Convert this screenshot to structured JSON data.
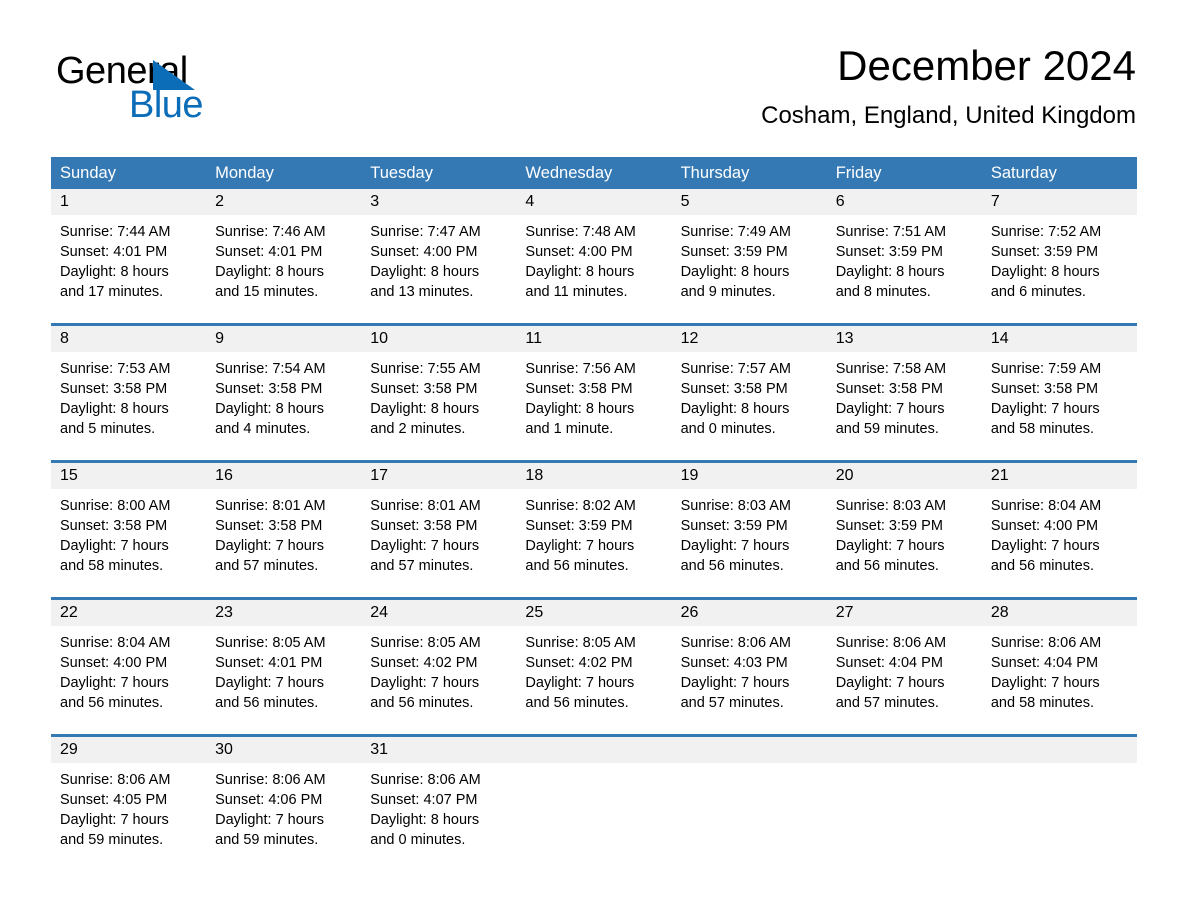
{
  "brand": {
    "name_part1": "General",
    "name_part2": "Blue",
    "triangle_color": "#0b6cb8"
  },
  "header": {
    "title": "December 2024",
    "location": "Cosham, England, United Kingdom"
  },
  "theme": {
    "header_blue": "#3579b4",
    "daynumber_band": "#f1f1f1",
    "text": "#000000"
  },
  "weekdays": [
    "Sunday",
    "Monday",
    "Tuesday",
    "Wednesday",
    "Thursday",
    "Friday",
    "Saturday"
  ],
  "weeks": [
    [
      {
        "day": "1",
        "sunrise": "Sunrise: 7:44 AM",
        "sunset": "Sunset: 4:01 PM",
        "daylight1": "Daylight: 8 hours",
        "daylight2": "and 17 minutes."
      },
      {
        "day": "2",
        "sunrise": "Sunrise: 7:46 AM",
        "sunset": "Sunset: 4:01 PM",
        "daylight1": "Daylight: 8 hours",
        "daylight2": "and 15 minutes."
      },
      {
        "day": "3",
        "sunrise": "Sunrise: 7:47 AM",
        "sunset": "Sunset: 4:00 PM",
        "daylight1": "Daylight: 8 hours",
        "daylight2": "and 13 minutes."
      },
      {
        "day": "4",
        "sunrise": "Sunrise: 7:48 AM",
        "sunset": "Sunset: 4:00 PM",
        "daylight1": "Daylight: 8 hours",
        "daylight2": "and 11 minutes."
      },
      {
        "day": "5",
        "sunrise": "Sunrise: 7:49 AM",
        "sunset": "Sunset: 3:59 PM",
        "daylight1": "Daylight: 8 hours",
        "daylight2": "and 9 minutes."
      },
      {
        "day": "6",
        "sunrise": "Sunrise: 7:51 AM",
        "sunset": "Sunset: 3:59 PM",
        "daylight1": "Daylight: 8 hours",
        "daylight2": "and 8 minutes."
      },
      {
        "day": "7",
        "sunrise": "Sunrise: 7:52 AM",
        "sunset": "Sunset: 3:59 PM",
        "daylight1": "Daylight: 8 hours",
        "daylight2": "and 6 minutes."
      }
    ],
    [
      {
        "day": "8",
        "sunrise": "Sunrise: 7:53 AM",
        "sunset": "Sunset: 3:58 PM",
        "daylight1": "Daylight: 8 hours",
        "daylight2": "and 5 minutes."
      },
      {
        "day": "9",
        "sunrise": "Sunrise: 7:54 AM",
        "sunset": "Sunset: 3:58 PM",
        "daylight1": "Daylight: 8 hours",
        "daylight2": "and 4 minutes."
      },
      {
        "day": "10",
        "sunrise": "Sunrise: 7:55 AM",
        "sunset": "Sunset: 3:58 PM",
        "daylight1": "Daylight: 8 hours",
        "daylight2": "and 2 minutes."
      },
      {
        "day": "11",
        "sunrise": "Sunrise: 7:56 AM",
        "sunset": "Sunset: 3:58 PM",
        "daylight1": "Daylight: 8 hours",
        "daylight2": "and 1 minute."
      },
      {
        "day": "12",
        "sunrise": "Sunrise: 7:57 AM",
        "sunset": "Sunset: 3:58 PM",
        "daylight1": "Daylight: 8 hours",
        "daylight2": "and 0 minutes."
      },
      {
        "day": "13",
        "sunrise": "Sunrise: 7:58 AM",
        "sunset": "Sunset: 3:58 PM",
        "daylight1": "Daylight: 7 hours",
        "daylight2": "and 59 minutes."
      },
      {
        "day": "14",
        "sunrise": "Sunrise: 7:59 AM",
        "sunset": "Sunset: 3:58 PM",
        "daylight1": "Daylight: 7 hours",
        "daylight2": "and 58 minutes."
      }
    ],
    [
      {
        "day": "15",
        "sunrise": "Sunrise: 8:00 AM",
        "sunset": "Sunset: 3:58 PM",
        "daylight1": "Daylight: 7 hours",
        "daylight2": "and 58 minutes."
      },
      {
        "day": "16",
        "sunrise": "Sunrise: 8:01 AM",
        "sunset": "Sunset: 3:58 PM",
        "daylight1": "Daylight: 7 hours",
        "daylight2": "and 57 minutes."
      },
      {
        "day": "17",
        "sunrise": "Sunrise: 8:01 AM",
        "sunset": "Sunset: 3:58 PM",
        "daylight1": "Daylight: 7 hours",
        "daylight2": "and 57 minutes."
      },
      {
        "day": "18",
        "sunrise": "Sunrise: 8:02 AM",
        "sunset": "Sunset: 3:59 PM",
        "daylight1": "Daylight: 7 hours",
        "daylight2": "and 56 minutes."
      },
      {
        "day": "19",
        "sunrise": "Sunrise: 8:03 AM",
        "sunset": "Sunset: 3:59 PM",
        "daylight1": "Daylight: 7 hours",
        "daylight2": "and 56 minutes."
      },
      {
        "day": "20",
        "sunrise": "Sunrise: 8:03 AM",
        "sunset": "Sunset: 3:59 PM",
        "daylight1": "Daylight: 7 hours",
        "daylight2": "and 56 minutes."
      },
      {
        "day": "21",
        "sunrise": "Sunrise: 8:04 AM",
        "sunset": "Sunset: 4:00 PM",
        "daylight1": "Daylight: 7 hours",
        "daylight2": "and 56 minutes."
      }
    ],
    [
      {
        "day": "22",
        "sunrise": "Sunrise: 8:04 AM",
        "sunset": "Sunset: 4:00 PM",
        "daylight1": "Daylight: 7 hours",
        "daylight2": "and 56 minutes."
      },
      {
        "day": "23",
        "sunrise": "Sunrise: 8:05 AM",
        "sunset": "Sunset: 4:01 PM",
        "daylight1": "Daylight: 7 hours",
        "daylight2": "and 56 minutes."
      },
      {
        "day": "24",
        "sunrise": "Sunrise: 8:05 AM",
        "sunset": "Sunset: 4:02 PM",
        "daylight1": "Daylight: 7 hours",
        "daylight2": "and 56 minutes."
      },
      {
        "day": "25",
        "sunrise": "Sunrise: 8:05 AM",
        "sunset": "Sunset: 4:02 PM",
        "daylight1": "Daylight: 7 hours",
        "daylight2": "and 56 minutes."
      },
      {
        "day": "26",
        "sunrise": "Sunrise: 8:06 AM",
        "sunset": "Sunset: 4:03 PM",
        "daylight1": "Daylight: 7 hours",
        "daylight2": "and 57 minutes."
      },
      {
        "day": "27",
        "sunrise": "Sunrise: 8:06 AM",
        "sunset": "Sunset: 4:04 PM",
        "daylight1": "Daylight: 7 hours",
        "daylight2": "and 57 minutes."
      },
      {
        "day": "28",
        "sunrise": "Sunrise: 8:06 AM",
        "sunset": "Sunset: 4:04 PM",
        "daylight1": "Daylight: 7 hours",
        "daylight2": "and 58 minutes."
      }
    ],
    [
      {
        "day": "29",
        "sunrise": "Sunrise: 8:06 AM",
        "sunset": "Sunset: 4:05 PM",
        "daylight1": "Daylight: 7 hours",
        "daylight2": "and 59 minutes."
      },
      {
        "day": "30",
        "sunrise": "Sunrise: 8:06 AM",
        "sunset": "Sunset: 4:06 PM",
        "daylight1": "Daylight: 7 hours",
        "daylight2": "and 59 minutes."
      },
      {
        "day": "31",
        "sunrise": "Sunrise: 8:06 AM",
        "sunset": "Sunset: 4:07 PM",
        "daylight1": "Daylight: 8 hours",
        "daylight2": "and 0 minutes."
      },
      {
        "day": "",
        "sunrise": "",
        "sunset": "",
        "daylight1": "",
        "daylight2": ""
      },
      {
        "day": "",
        "sunrise": "",
        "sunset": "",
        "daylight1": "",
        "daylight2": ""
      },
      {
        "day": "",
        "sunrise": "",
        "sunset": "",
        "daylight1": "",
        "daylight2": ""
      },
      {
        "day": "",
        "sunrise": "",
        "sunset": "",
        "daylight1": "",
        "daylight2": ""
      }
    ]
  ]
}
